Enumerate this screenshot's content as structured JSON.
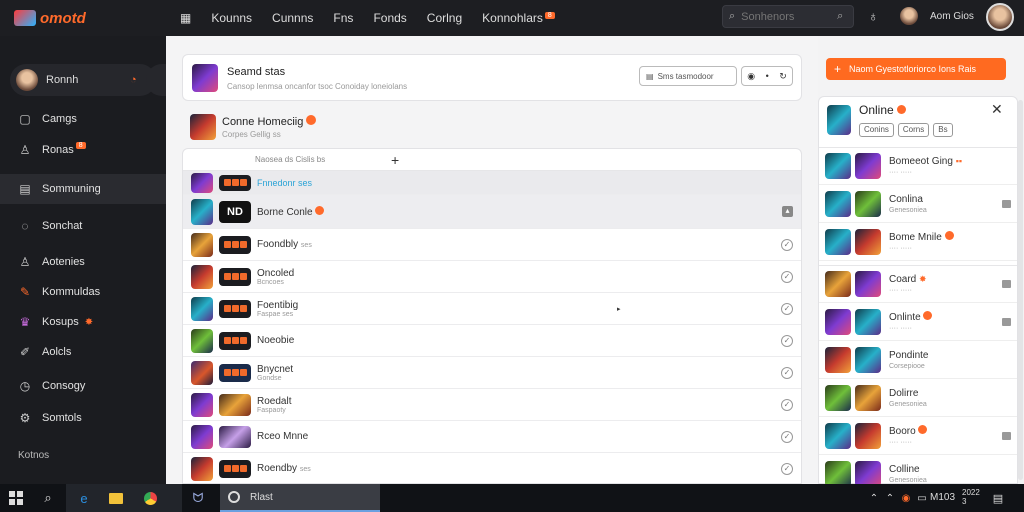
{
  "topbar": {
    "logo_text": "omotd",
    "nav": [
      {
        "label": "Kounns"
      },
      {
        "label": "Cunnns"
      },
      {
        "label": "Fns"
      },
      {
        "label": "Fonds"
      },
      {
        "label": "Corlng"
      },
      {
        "label": "Konnohlars",
        "badge": "8"
      }
    ],
    "search_placeholder": "Sonhenors",
    "user_name": "Aom Gios"
  },
  "sidebar": {
    "user": "Ronnh",
    "items": [
      {
        "label": "Camgs",
        "icon": "document-icon"
      },
      {
        "label": "Ronas",
        "icon": "person-icon",
        "badge": "8"
      },
      {
        "label": "Sommuning",
        "icon": "news-icon",
        "active": true
      },
      {
        "label": "Sonchat",
        "icon": "chat-icon"
      },
      {
        "label": "Aotenies",
        "icon": "person-icon"
      },
      {
        "label": "Kommuldas",
        "icon": "pencil-icon"
      },
      {
        "label": "Kosups",
        "icon": "group-icon",
        "badge": "✸"
      },
      {
        "label": "Aolcls",
        "icon": "edit-icon"
      },
      {
        "label": "Consogy",
        "icon": "clock-icon"
      },
      {
        "label": "Somtols",
        "icon": "gear-icon"
      }
    ],
    "footer": "Kotnos"
  },
  "main": {
    "search_card": {
      "title": "Seamd stas",
      "subtitle": "Cansop lenmsa oncanfor tsoc  Conoiday loneiolans",
      "button_label": "Sms tasmodoor"
    },
    "group": {
      "title": "Conne Homeciig",
      "subtitle": "Corpes Gellig ss"
    },
    "list_header": "Naosea ds  Cislis  bs",
    "rows": [
      {
        "name": "Fnnedonr ses",
        "highlight": true,
        "thumb": "g4"
      },
      {
        "name": "Borne Conle",
        "badge": true,
        "selected": true,
        "thumb": "g3"
      },
      {
        "name": "Foondbly",
        "sub": "ses",
        "thumb": "g6"
      },
      {
        "name": "Oncoled",
        "sub": "Bcncoes",
        "thumb": "g2"
      },
      {
        "name": "Foentibig",
        "sub": "Faspae ses",
        "thumb": "g3"
      },
      {
        "name": "Noeobie",
        "sub": "",
        "thumb": "g5"
      },
      {
        "name": "Bnycnet",
        "sub": "Gondse",
        "thumb": "g1"
      },
      {
        "name": "Roedalt",
        "sub": "Faspaoty",
        "thumb": "g4"
      },
      {
        "name": "Rceo Mnne",
        "sub": "",
        "thumb": "g4"
      },
      {
        "name": "Roendby",
        "sub": "ses",
        "thumb": "g2"
      }
    ]
  },
  "right": {
    "cta_label": "Naom Gyestotloriorco Ions Rais",
    "panel_title": "Online",
    "chips": [
      "Conins",
      "Corns",
      "Bs"
    ],
    "friends": [
      {
        "name": "Bomeeot Ging",
        "badge": true,
        "thumb": "g3"
      },
      {
        "name": "Conlina",
        "sub": "Genesoniea",
        "thumb": "g3"
      },
      {
        "name": "Bome Mnile",
        "badge": true,
        "thumb": "g3"
      },
      {
        "name": "Coard",
        "badge": true,
        "thumb": "g6"
      },
      {
        "name": "Onlinte",
        "badge": true,
        "thumb": "g4"
      },
      {
        "name": "Pondinte",
        "sub": "Corsepiooe",
        "thumb": "g2"
      },
      {
        "name": "Dolirre",
        "sub": "Genesoniea",
        "thumb": "g5"
      },
      {
        "name": "Booro",
        "badge": true,
        "thumb": "g3"
      },
      {
        "name": "Colline",
        "sub": "Genesoniea",
        "thumb": "g5"
      }
    ]
  },
  "taskbar": {
    "active_app": "Rlast",
    "time": "M103",
    "date": "2022 3"
  }
}
